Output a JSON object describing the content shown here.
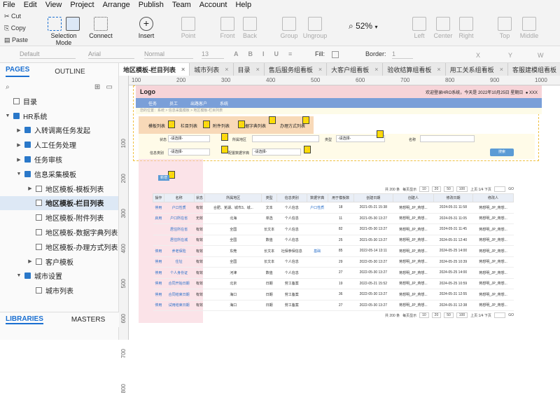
{
  "menu": [
    "File",
    "Edit",
    "View",
    "Project",
    "Arrange",
    "Publish",
    "Team",
    "Account",
    "Help"
  ],
  "clipboard": {
    "cut": "Cut",
    "copy": "Copy",
    "paste": "Paste"
  },
  "toolbar": {
    "selection": "Selection Mode",
    "connect": "Connect",
    "insert": "Insert",
    "point": "Point",
    "front": "Front",
    "back": "Back",
    "group": "Group",
    "ungroup": "Ungroup",
    "zoom": "52%",
    "left": "Left",
    "center": "Center",
    "right": "Right",
    "top": "Top",
    "middle": "Middle"
  },
  "format": {
    "style": "Default",
    "font": "Arial",
    "weight": "Normal",
    "size": "13",
    "fill": "Fill:",
    "border": "Border:",
    "border_w": "1",
    "x": "X",
    "y": "Y",
    "w": "W"
  },
  "left": {
    "tab_pages": "PAGES",
    "tab_outline": "OUTLINE",
    "tab_libraries": "LIBRARIES",
    "tab_masters": "MASTERS",
    "tree": [
      {
        "label": "目录",
        "type": "page",
        "depth": 0,
        "arrow": ""
      },
      {
        "label": "HR系统",
        "type": "folder",
        "depth": 0,
        "arrow": "▼"
      },
      {
        "label": "入转调离任务发起",
        "type": "folder",
        "depth": 1,
        "arrow": "▶"
      },
      {
        "label": "人工任务处理",
        "type": "folder",
        "depth": 1,
        "arrow": "▶"
      },
      {
        "label": "任务审核",
        "type": "folder",
        "depth": 1,
        "arrow": "▶"
      },
      {
        "label": "信息采集模板",
        "type": "folder",
        "depth": 1,
        "arrow": "▼"
      },
      {
        "label": "地区模板-模板列表",
        "type": "page",
        "depth": 2,
        "arrow": "▶"
      },
      {
        "label": "地区模板-栏目列表",
        "type": "page",
        "depth": 2,
        "arrow": "",
        "selected": true
      },
      {
        "label": "地区模板-附件列表",
        "type": "page",
        "depth": 2,
        "arrow": ""
      },
      {
        "label": "地区模板-数据字典列表",
        "type": "page",
        "depth": 2,
        "arrow": ""
      },
      {
        "label": "地区模板-办理方式列表",
        "type": "page",
        "depth": 2,
        "arrow": ""
      },
      {
        "label": "客户模板",
        "type": "page",
        "depth": 2,
        "arrow": "▶"
      },
      {
        "label": "城市设置",
        "type": "folder",
        "depth": 1,
        "arrow": "▼"
      },
      {
        "label": "城市列表",
        "type": "page",
        "depth": 2,
        "arrow": ""
      }
    ]
  },
  "tabs": [
    "地区模板-栏目列表",
    "城市列表",
    "目录",
    "售后服务组看板",
    "大客户组看板",
    "验收结算组看板",
    "用工关系组看板",
    "客服建模组看板"
  ],
  "ruler": {
    "h": [
      "100",
      "200",
      "300",
      "400",
      "500",
      "600",
      "700",
      "800",
      "900",
      "1000"
    ],
    "v": [
      "100",
      "200",
      "300",
      "400",
      "500",
      "600",
      "700",
      "800"
    ]
  },
  "proto": {
    "logo": "Logo",
    "welcome": "欢迎登录HRO系统，今天是 2022年10月25日 星期日",
    "user": "XXX",
    "nav": [
      "任务",
      "员工",
      "出路客户",
      "系统"
    ],
    "crumb": "您的位置：系统 > 信息采集模板 > 地区模板-栏目列表",
    "ribbon": [
      "模板列表",
      "栏目列表",
      "附件列表",
      "数据字典列表",
      "办理方式列表"
    ],
    "form": {
      "status": "状态",
      "status_ph": "-请选择-",
      "region": "所属地区",
      "type": "类型",
      "type_ph": "-请选择-",
      "name": "名称",
      "info": "信息类别",
      "info_ph": "-请选择-",
      "dict": "配置数据字典",
      "dict_ph": "-请选择-",
      "query": "搜索"
    },
    "add": "新增",
    "pager": {
      "total": "共 200 条",
      "per": "每页显示",
      "sizes": [
        "10",
        "20",
        "50",
        "100"
      ],
      "page": "上页 1/4 下页",
      "goto": "GO"
    },
    "columns": [
      "操作",
      "名称",
      "状态",
      "所属地区",
      "类型",
      "信息类别",
      "数据字典",
      "用于模板数",
      "创建日期",
      "创建人",
      "修改日期",
      "修改人"
    ],
    "rows": [
      [
        "停用",
        "户口性质",
        "有效",
        "合肥、芜湖、城市3、城...",
        "文本",
        "个人信息",
        "户口性质",
        "18",
        "2021-05-21 15:38",
        "蒋想明_JP_蒋想...",
        "2024-05-31 11:58",
        "蒋想明_JP_蒋想..."
      ],
      [
        "启用",
        "户口所在省",
        "无效",
        "北海",
        "单选",
        "个人信息",
        "",
        "11",
        "2021-05-30 13:27",
        "蒋想明_JP_蒋想...",
        "2024-05-31 11:05",
        "蒋想明_JP_蒋想..."
      ],
      [
        "",
        "居住所在省",
        "有效",
        "全国",
        "长文本",
        "个人信息",
        "",
        "82",
        "2021-05-30 13:27",
        "蒋想明_JP_蒋想...",
        "2024-05-31 11:45",
        "蒋想明_JP_蒋想..."
      ],
      [
        "",
        "居住所在城",
        "有效",
        "全国",
        "数值",
        "个人信息",
        "",
        "25",
        "2021-05-30 13:27",
        "蒋想明_JP_蒋想...",
        "2024-05-31 12:40",
        "蒋想明_JP_蒋想..."
      ],
      [
        "停用",
        "养老保险",
        "有效",
        "东莞",
        "长文本",
        "社保参保信息",
        "基础",
        "85",
        "2022-05-14 13:11",
        "蒋想明_JP_蒋想...",
        "2024-05-25 14:00",
        "蒋想明_JP_蒋想..."
      ],
      [
        "停用",
        "住址",
        "有效",
        "全国",
        "长文本",
        "个人信息",
        "",
        "29",
        "2022-05-30 13:27",
        "蒋想明_JP_蒋想...",
        "2024-05-25 10:39",
        "蒋想明_JP_蒋想..."
      ],
      [
        "停用",
        "个人身份证",
        "有效",
        "河津",
        "数值",
        "个人信息",
        "",
        "27",
        "2022-05-30 13:27",
        "蒋想明_JP_蒋想...",
        "2024-05-25 14:00",
        "蒋想明_JP_蒋想..."
      ],
      [
        "停用",
        "合同开始日期",
        "有效",
        "北京",
        "日期",
        "劳工备案",
        "",
        "19",
        "2022-05-21 15:52",
        "蒋想明_JP_蒋想...",
        "2024-05-25 10:59",
        "蒋想明_JP_蒋想..."
      ],
      [
        "停用",
        "合同结束日期",
        "有效",
        "海口",
        "日期",
        "劳工备案",
        "",
        "36",
        "2022-05-30 13:27",
        "蒋想明_JP_蒋想...",
        "2024-05-31 12:55",
        "蒋想明_JP_蒋想..."
      ],
      [
        "停用",
        "试用结束日期",
        "有效",
        "海口",
        "日期",
        "劳工备案",
        "",
        "27",
        "2022-05-30 13:27",
        "蒋想明_JP_蒋想...",
        "2024-05-31 12:38",
        "蒋想明_JP_蒋想..."
      ]
    ]
  }
}
